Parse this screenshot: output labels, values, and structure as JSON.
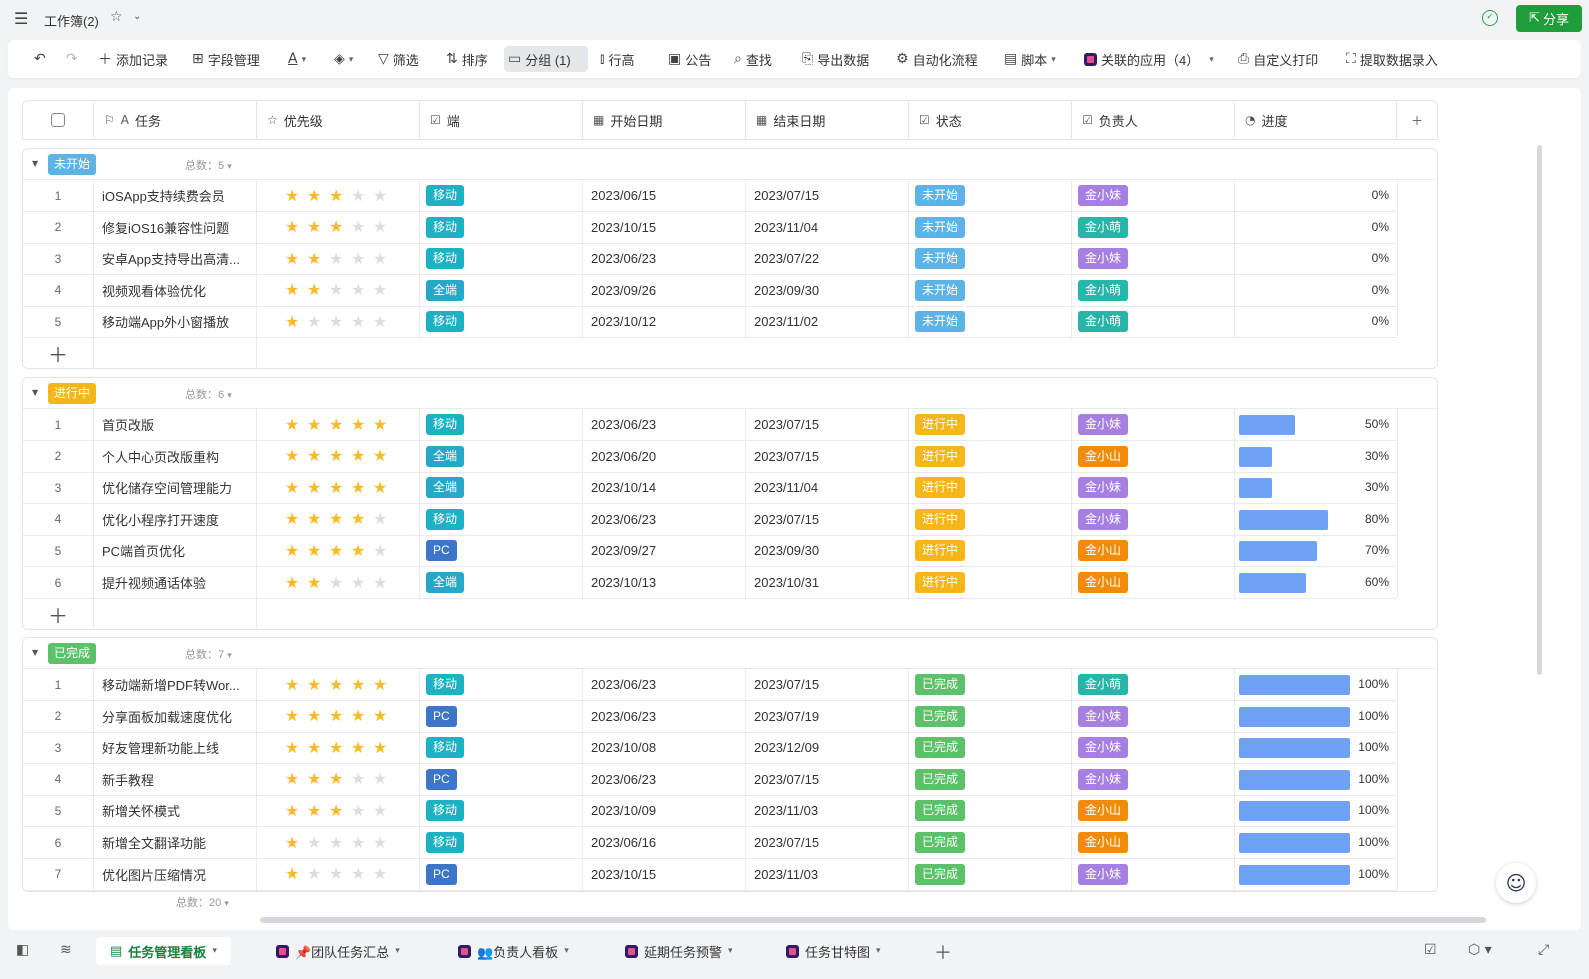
{
  "window": {
    "title": "工作簿(2)",
    "share_label": "分享"
  },
  "toolbar": {
    "add_record": "添加记录",
    "fields": "字段管理",
    "filter": "筛选",
    "sort": "排序",
    "group": "分组 (1)",
    "row_height": "行高",
    "notice": "公告",
    "find": "查找",
    "export": "导出数据",
    "automation": "自动化流程",
    "script": "脚本",
    "linked_apps": "关联的应用（4）",
    "custom_print": "自定义打印",
    "extract": "提取数据录入"
  },
  "columns": {
    "task": "任务",
    "priority": "优先级",
    "device": "端",
    "start": "开始日期",
    "end": "结束日期",
    "status": "状态",
    "owner": "负责人",
    "progress": "进度"
  },
  "colors": {
    "not_started": "#5db3e6",
    "in_progress": "#f5b619",
    "done": "#5cc26a",
    "mobile": "#1cb2c4",
    "all": "#27a8c9",
    "pc": "#3d76c9",
    "jin_mei": "#a77fe0",
    "jin_meng": "#26b5a8",
    "jin_shan": "#f08c0a"
  },
  "groups": [
    {
      "name": "未开始",
      "count_label": "总数：5",
      "rows": [
        {
          "idx": "1",
          "task": "iOSApp支持续费会员",
          "stars": 3,
          "device": "移动",
          "start": "2023/06/15",
          "end": "2023/07/15",
          "status": "未开始",
          "owner": "金小妹",
          "progress": 0,
          "progress_label": "0%"
        },
        {
          "idx": "2",
          "task": "修复iOS16兼容性问题",
          "stars": 3,
          "device": "移动",
          "start": "2023/10/15",
          "end": "2023/11/04",
          "status": "未开始",
          "owner": "金小萌",
          "progress": 0,
          "progress_label": "0%"
        },
        {
          "idx": "3",
          "task": "安卓App支持导出高清...",
          "stars": 2,
          "device": "移动",
          "start": "2023/06/23",
          "end": "2023/07/22",
          "status": "未开始",
          "owner": "金小妹",
          "progress": 0,
          "progress_label": "0%"
        },
        {
          "idx": "4",
          "task": "视频观看体验优化",
          "stars": 2,
          "device": "全端",
          "start": "2023/09/26",
          "end": "2023/09/30",
          "status": "未开始",
          "owner": "金小萌",
          "progress": 0,
          "progress_label": "0%"
        },
        {
          "idx": "5",
          "task": "移动端App外小窗播放",
          "stars": 1,
          "device": "移动",
          "start": "2023/10/12",
          "end": "2023/11/02",
          "status": "未开始",
          "owner": "金小萌",
          "progress": 0,
          "progress_label": "0%"
        }
      ]
    },
    {
      "name": "进行中",
      "count_label": "总数：6",
      "rows": [
        {
          "idx": "1",
          "task": "首页改版",
          "stars": 5,
          "device": "移动",
          "start": "2023/06/23",
          "end": "2023/07/15",
          "status": "进行中",
          "owner": "金小妹",
          "progress": 50,
          "progress_label": "50%"
        },
        {
          "idx": "2",
          "task": "个人中心页改版重构",
          "stars": 5,
          "device": "全端",
          "start": "2023/06/20",
          "end": "2023/07/15",
          "status": "进行中",
          "owner": "金小山",
          "progress": 30,
          "progress_label": "30%"
        },
        {
          "idx": "3",
          "task": "优化储存空间管理能力",
          "stars": 5,
          "device": "全端",
          "start": "2023/10/14",
          "end": "2023/11/04",
          "status": "进行中",
          "owner": "金小妹",
          "progress": 30,
          "progress_label": "30%"
        },
        {
          "idx": "4",
          "task": "优化小程序打开速度",
          "stars": 4,
          "device": "移动",
          "start": "2023/06/23",
          "end": "2023/07/15",
          "status": "进行中",
          "owner": "金小妹",
          "progress": 80,
          "progress_label": "80%"
        },
        {
          "idx": "5",
          "task": "PC端首页优化",
          "stars": 4,
          "device": "PC",
          "start": "2023/09/27",
          "end": "2023/09/30",
          "status": "进行中",
          "owner": "金小山",
          "progress": 70,
          "progress_label": "70%"
        },
        {
          "idx": "6",
          "task": "提升视频通话体验",
          "stars": 2,
          "device": "全端",
          "start": "2023/10/13",
          "end": "2023/10/31",
          "status": "进行中",
          "owner": "金小山",
          "progress": 60,
          "progress_label": "60%"
        }
      ]
    },
    {
      "name": "已完成",
      "count_label": "总数：7",
      "rows": [
        {
          "idx": "1",
          "task": "移动端新增PDF转Wor...",
          "stars": 5,
          "device": "移动",
          "start": "2023/06/23",
          "end": "2023/07/15",
          "status": "已完成",
          "owner": "金小萌",
          "progress": 100,
          "progress_label": "100%"
        },
        {
          "idx": "2",
          "task": "分享面板加载速度优化",
          "stars": 5,
          "device": "PC",
          "start": "2023/06/23",
          "end": "2023/07/19",
          "status": "已完成",
          "owner": "金小妹",
          "progress": 100,
          "progress_label": "100%"
        },
        {
          "idx": "3",
          "task": "好友管理新功能上线",
          "stars": 5,
          "device": "移动",
          "start": "2023/10/08",
          "end": "2023/12/09",
          "status": "已完成",
          "owner": "金小妹",
          "progress": 100,
          "progress_label": "100%"
        },
        {
          "idx": "4",
          "task": "新手教程",
          "stars": 3,
          "device": "PC",
          "start": "2023/06/23",
          "end": "2023/07/15",
          "status": "已完成",
          "owner": "金小妹",
          "progress": 100,
          "progress_label": "100%"
        },
        {
          "idx": "5",
          "task": "新增关怀模式",
          "stars": 3,
          "device": "移动",
          "start": "2023/10/09",
          "end": "2023/11/03",
          "status": "已完成",
          "owner": "金小山",
          "progress": 100,
          "progress_label": "100%"
        },
        {
          "idx": "6",
          "task": "新增全文翻译功能",
          "stars": 1,
          "device": "移动",
          "start": "2023/06/16",
          "end": "2023/07/15",
          "status": "已完成",
          "owner": "金小山",
          "progress": 100,
          "progress_label": "100%"
        },
        {
          "idx": "7",
          "task": "优化图片压缩情况",
          "stars": 1,
          "device": "PC",
          "start": "2023/10/15",
          "end": "2023/11/03",
          "status": "已完成",
          "owner": "金小妹",
          "progress": 100,
          "progress_label": "100%"
        }
      ]
    }
  ],
  "footer": {
    "total_label": "总数：20"
  },
  "sheets": [
    {
      "name": "任务管理看板",
      "active": true
    },
    {
      "name": "📌团队任务汇总",
      "active": false
    },
    {
      "name": "👥负责人看板",
      "active": false
    },
    {
      "name": "延期任务预警",
      "active": false
    },
    {
      "name": "任务甘特图",
      "active": false
    }
  ]
}
